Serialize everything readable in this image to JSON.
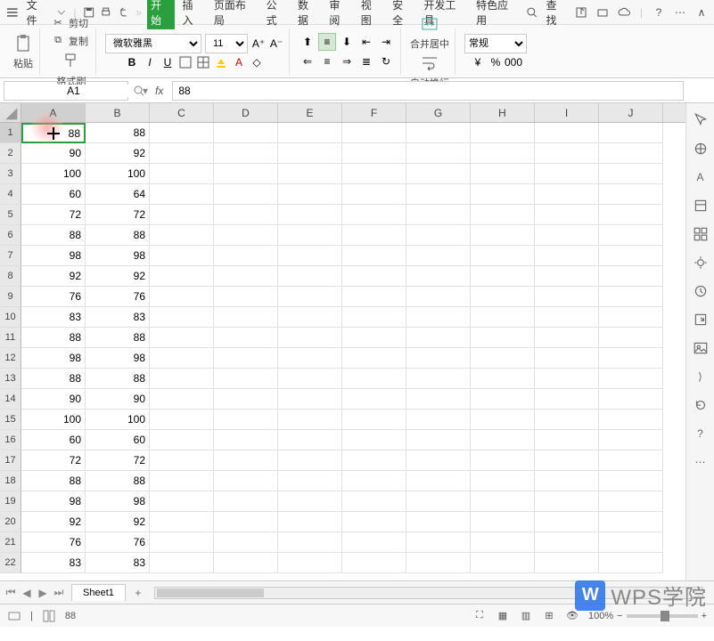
{
  "menubar": {
    "file": "文件",
    "tabs": [
      "开始",
      "插入",
      "页面布局",
      "公式",
      "数据",
      "审阅",
      "视图",
      "安全",
      "开发工具",
      "特色应用"
    ],
    "search": "查找"
  },
  "ribbon": {
    "paste": "粘贴",
    "cut": "剪切",
    "copy": "复制",
    "format_painter": "格式刷",
    "font_name": "微软雅黑",
    "font_size": "11",
    "merge_center": "合并居中",
    "wrap_text": "自动换行",
    "number_format": "常规"
  },
  "formula_bar": {
    "name_box": "A1",
    "formula": "88"
  },
  "grid": {
    "columns": [
      "A",
      "B",
      "C",
      "D",
      "E",
      "F",
      "G",
      "H",
      "I",
      "J"
    ],
    "selected_cell": "A1",
    "rows": [
      {
        "n": 1,
        "a": "88",
        "b": "88"
      },
      {
        "n": 2,
        "a": "90",
        "b": "92"
      },
      {
        "n": 3,
        "a": "100",
        "b": "100"
      },
      {
        "n": 4,
        "a": "60",
        "b": "64"
      },
      {
        "n": 5,
        "a": "72",
        "b": "72"
      },
      {
        "n": 6,
        "a": "88",
        "b": "88"
      },
      {
        "n": 7,
        "a": "98",
        "b": "98"
      },
      {
        "n": 8,
        "a": "92",
        "b": "92"
      },
      {
        "n": 9,
        "a": "76",
        "b": "76"
      },
      {
        "n": 10,
        "a": "83",
        "b": "83"
      },
      {
        "n": 11,
        "a": "88",
        "b": "88"
      },
      {
        "n": 12,
        "a": "98",
        "b": "98"
      },
      {
        "n": 13,
        "a": "88",
        "b": "88"
      },
      {
        "n": 14,
        "a": "90",
        "b": "90"
      },
      {
        "n": 15,
        "a": "100",
        "b": "100"
      },
      {
        "n": 16,
        "a": "60",
        "b": "60"
      },
      {
        "n": 17,
        "a": "72",
        "b": "72"
      },
      {
        "n": 18,
        "a": "88",
        "b": "88"
      },
      {
        "n": 19,
        "a": "98",
        "b": "98"
      },
      {
        "n": 20,
        "a": "92",
        "b": "92"
      },
      {
        "n": 21,
        "a": "76",
        "b": "76"
      },
      {
        "n": 22,
        "a": "83",
        "b": "83"
      }
    ]
  },
  "tabs": {
    "sheet1": "Sheet1"
  },
  "statusbar": {
    "value": "88",
    "zoom": "100%"
  },
  "watermark": {
    "logo": "W",
    "text": "WPS学院"
  }
}
